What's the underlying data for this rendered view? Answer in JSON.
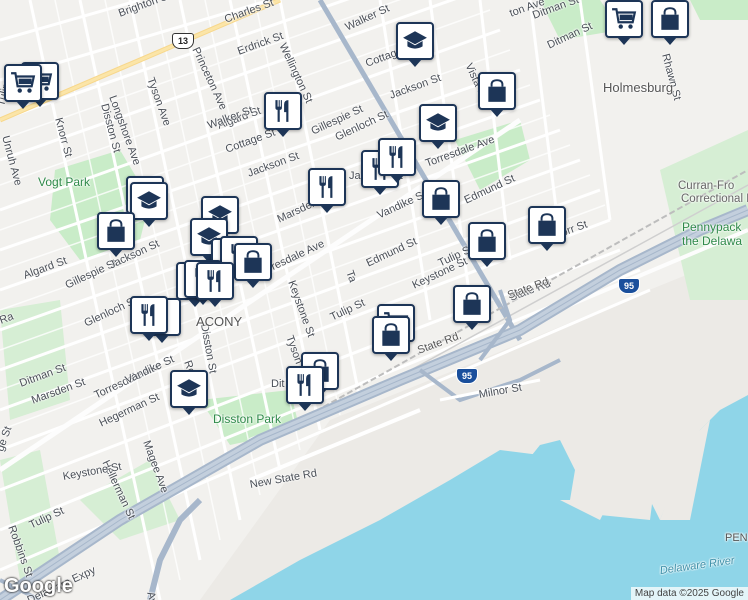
{
  "map": {
    "attribution": "Map data ©2025 Google",
    "logo": "Google"
  },
  "streets": [
    {
      "text": "Brighton St"
    },
    {
      "text": "Charles St"
    },
    {
      "text": "Erdrick St"
    },
    {
      "text": "Wellington St"
    },
    {
      "text": "Princeton Ave"
    },
    {
      "text": "Tyson Ave"
    },
    {
      "text": "Disston St"
    },
    {
      "text": "Longshore Ave"
    },
    {
      "text": "Knorr St"
    },
    {
      "text": "Unruh Ave"
    },
    {
      "text": "Walker St"
    },
    {
      "text": "Algard St"
    },
    {
      "text": "Cottage St"
    },
    {
      "text": "Gillespie St"
    },
    {
      "text": "Glenloch St"
    },
    {
      "text": "Jackson St"
    },
    {
      "text": "Marsden St"
    },
    {
      "text": "Torresdale Ave"
    },
    {
      "text": "Vandike St"
    },
    {
      "text": "Edmund St"
    },
    {
      "text": "Tulip St"
    },
    {
      "text": "Keystone St"
    },
    {
      "text": "State Rd"
    },
    {
      "text": "Milnor St"
    },
    {
      "text": "New State Rd"
    },
    {
      "text": "Delaware Expy"
    },
    {
      "text": "Rhawn St"
    },
    {
      "text": "Ditman St"
    },
    {
      "text": "Vista St"
    },
    {
      "text": "Hegerman St"
    },
    {
      "text": "Magee Ave"
    },
    {
      "text": "Hellerman St"
    },
    {
      "text": "Robbins St"
    },
    {
      "text": "Walker St"
    },
    {
      "text": "Cottage St"
    },
    {
      "text": "Jackson St"
    },
    {
      "text": "Glenloch St"
    },
    {
      "text": "Gillespie St"
    },
    {
      "text": "Algard St"
    },
    {
      "text": "Jackson St"
    },
    {
      "text": "Torresdale Ave"
    },
    {
      "text": "Vandike St"
    },
    {
      "text": "Marsden St"
    },
    {
      "text": "Ditman St"
    },
    {
      "text": "Keystone St"
    },
    {
      "text": "Tulip St"
    },
    {
      "text": "Torresdale Ave"
    },
    {
      "text": "Edmund St"
    },
    {
      "text": "Tulip St"
    },
    {
      "text": "Keystone St"
    },
    {
      "text": "Tyson Ave"
    },
    {
      "text": "Disston St"
    },
    {
      "text": "Knorr St"
    },
    {
      "text": "Ditman St"
    },
    {
      "text": "Tulip St"
    },
    {
      "text": "Jackson St"
    },
    {
      "text": "Ro"
    },
    {
      "text": "Dit"
    },
    {
      "text": "Ra"
    },
    {
      "text": "Ta"
    },
    {
      "text": "ge St"
    },
    {
      "text": "ton Ave"
    },
    {
      "text": "Ave"
    },
    {
      "text": "Jackso"
    },
    {
      "text": "Ta"
    }
  ],
  "places": [
    {
      "text": "Vogt Park",
      "kind": "park"
    },
    {
      "text": "Disston Park",
      "kind": "park"
    },
    {
      "text": "ACONY",
      "kind": "big"
    },
    {
      "text": "Holmesburg",
      "kind": "big"
    },
    {
      "text": "Curran-Fro",
      "kind": "poi"
    },
    {
      "text": "Correctional F",
      "kind": "poi"
    },
    {
      "text": "Pennypack",
      "kind": "park"
    },
    {
      "text": "the Delawa",
      "kind": "park"
    },
    {
      "text": "Delaware River",
      "kind": "water"
    },
    {
      "text": "PEN",
      "kind": "hwy"
    },
    {
      "text": "State Rd.",
      "kind": "hwy"
    },
    {
      "text": "State Rd.",
      "kind": "hwy"
    }
  ],
  "shields": [
    {
      "text": "13",
      "kind": "us"
    },
    {
      "text": "95",
      "kind": "i95"
    },
    {
      "text": "95",
      "kind": "i95"
    }
  ],
  "pins": [
    {
      "icon": "shopping-cart-icon"
    },
    {
      "icon": "shopping-cart-icon"
    },
    {
      "icon": "shopping-bag-icon"
    },
    {
      "icon": "shopping-cart-icon"
    },
    {
      "icon": "school-icon"
    },
    {
      "icon": "school-icon"
    },
    {
      "icon": "shopping-bag-icon"
    },
    {
      "icon": "restaurant-icon"
    },
    {
      "icon": "school-icon"
    },
    {
      "icon": "restaurant-icon"
    },
    {
      "icon": "restaurant-icon"
    },
    {
      "icon": "restaurant-icon"
    },
    {
      "icon": "school-icon"
    },
    {
      "icon": "school-icon"
    },
    {
      "icon": "shopping-bag-icon"
    },
    {
      "icon": "school-icon"
    },
    {
      "icon": "shopping-bag-icon"
    },
    {
      "icon": "restaurant-icon"
    },
    {
      "icon": "shopping-bag-icon"
    },
    {
      "icon": "restaurant-icon"
    },
    {
      "icon": "restaurant-icon"
    },
    {
      "icon": "restaurant-icon"
    },
    {
      "icon": "shopping-bag-icon"
    },
    {
      "icon": "shopping-bag-icon"
    },
    {
      "icon": "restaurant-icon"
    },
    {
      "icon": "restaurant-icon"
    },
    {
      "icon": "shopping-bag-icon"
    },
    {
      "icon": "shopping-bag-icon"
    },
    {
      "icon": "shopping-cart-icon"
    },
    {
      "icon": "shopping-bag-icon"
    },
    {
      "icon": "shopping-bag-icon"
    },
    {
      "icon": "restaurant-icon"
    },
    {
      "icon": "school-icon"
    }
  ],
  "colors": {
    "land": "#f2f1ee",
    "water": "#8fd5e8",
    "park": "#c9ecc8",
    "highway": "#a7b7cb",
    "street": "#ffffff",
    "pin_border": "#1d3557",
    "rail": "#bdbdbd"
  }
}
